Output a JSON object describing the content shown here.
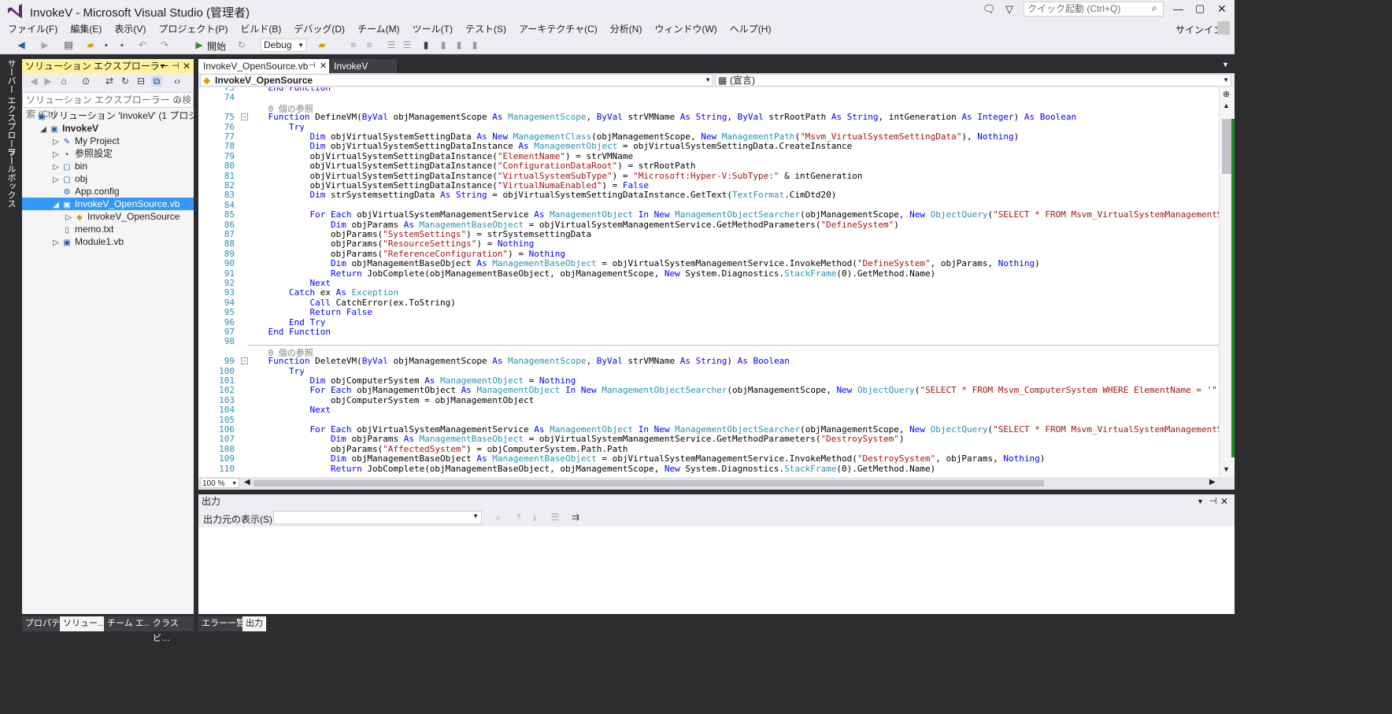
{
  "window": {
    "title": "InvokeV - Microsoft Visual Studio (管理者)",
    "quick_launch_placeholder": "クイック起動 (Ctrl+Q)",
    "sign_in": "サインイン"
  },
  "menu": [
    "ファイル(F)",
    "編集(E)",
    "表示(V)",
    "プロジェクト(P)",
    "ビルド(B)",
    "デバッグ(D)",
    "チーム(M)",
    "ツール(T)",
    "テスト(S)",
    "アーキテクチャ(C)",
    "分析(N)",
    "ウィンドウ(W)",
    "ヘルプ(H)"
  ],
  "toolbar": {
    "start_label": "開始",
    "config": "Debug"
  },
  "left_tabs": [
    "サーバー エクスプローラー",
    "ツールボックス"
  ],
  "solution_explorer": {
    "title": "ソリューション エクスプローラー",
    "search_placeholder": "ソリューション エクスプローラー の検索 (Ctrl",
    "tree": [
      {
        "label": "ソリューション 'InvokeV' (1 プロジェクト)",
        "level": 0,
        "icon": "solution-icon",
        "expander": ""
      },
      {
        "label": "InvokeV",
        "level": 1,
        "icon": "vb-project-icon",
        "expander": "◢",
        "bold": true
      },
      {
        "label": "My Project",
        "level": 2,
        "icon": "wrench-icon",
        "expander": "▷"
      },
      {
        "label": "参照設定",
        "level": 2,
        "icon": "references-icon",
        "expander": "▷"
      },
      {
        "label": "bin",
        "level": 2,
        "icon": "folder-icon",
        "expander": "▷"
      },
      {
        "label": "obj",
        "level": 2,
        "icon": "folder-icon",
        "expander": "▷"
      },
      {
        "label": "App.config",
        "level": 2,
        "icon": "config-icon",
        "expander": ""
      },
      {
        "label": "InvokeV_OpenSource.vb",
        "level": 2,
        "icon": "vb-file-icon",
        "expander": "◢",
        "selected": true
      },
      {
        "label": "InvokeV_OpenSource",
        "level": 3,
        "icon": "class-icon",
        "expander": "▷"
      },
      {
        "label": "memo.txt",
        "level": 2,
        "icon": "text-file-icon",
        "expander": ""
      },
      {
        "label": "Module1.vb",
        "level": 2,
        "icon": "vb-file-icon",
        "expander": "▷"
      }
    ],
    "bottom_tabs": [
      "プロパティ",
      "ソリュー…",
      "チーム エ…",
      "クラス ビ…"
    ]
  },
  "editor": {
    "tabs": [
      {
        "label": "InvokeV_OpenSource.vb",
        "active": true
      },
      {
        "label": "InvokeV",
        "active": false
      }
    ],
    "nav_left": "InvokeV_OpenSource",
    "nav_right": "(宣言)",
    "zoom": "100 %",
    "lines": [
      {
        "n": "73",
        "t": "    End Function"
      },
      {
        "n": "74",
        "t": ""
      },
      {
        "n": "",
        "t": "    0 個の参照"
      },
      {
        "n": "75",
        "t": "    Function DefineVM(ByVal objManagementScope As ManagementScope, ByVal strVMName As String, ByVal strRootPath As String, intGeneration As Integer) As Boolean"
      },
      {
        "n": "76",
        "t": "        Try"
      },
      {
        "n": "77",
        "t": "            Dim objVirtualSystemSettingData As New ManagementClass(objManagementScope, New ManagementPath(\"Msvm_VirtualSystemSettingData\"), Nothing)"
      },
      {
        "n": "78",
        "t": "            Dim objVirtualSystemSettingDataInstance As ManagementObject = objVirtualSystemSettingData.CreateInstance"
      },
      {
        "n": "79",
        "t": "            objVirtualSystemSettingDataInstance(\"ElementName\") = strVMName"
      },
      {
        "n": "80",
        "t": "            objVirtualSystemSettingDataInstance(\"ConfigurationDataRoot\") = strRootPath"
      },
      {
        "n": "81",
        "t": "            objVirtualSystemSettingDataInstance(\"VirtualSystemSubType\") = \"Microsoft:Hyper-V:SubType:\" & intGeneration"
      },
      {
        "n": "82",
        "t": "            objVirtualSystemSettingDataInstance(\"VirtualNumaEnabled\") = False"
      },
      {
        "n": "83",
        "t": "            Dim strSystemsettingData As String = objVirtualSystemSettingDataInstance.GetText(TextFormat.CimDtd20)"
      },
      {
        "n": "84",
        "t": ""
      },
      {
        "n": "85",
        "t": "            For Each objVirtualSystemManagementService As ManagementObject In New ManagementObjectSearcher(objManagementScope, New ObjectQuery(\"SELECT * FROM Msvm_VirtualSystemManagementService\")).Ge"
      },
      {
        "n": "86",
        "t": "                Dim objParams As ManagementBaseObject = objVirtualSystemManagementService.GetMethodParameters(\"DefineSystem\")"
      },
      {
        "n": "87",
        "t": "                objParams(\"SystemSettings\") = strSystemsettingData"
      },
      {
        "n": "88",
        "t": "                objParams(\"ResourceSettings\") = Nothing"
      },
      {
        "n": "89",
        "t": "                objParams(\"ReferenceConfiguration\") = Nothing"
      },
      {
        "n": "90",
        "t": "                Dim objManagementBaseObject As ManagementBaseObject = objVirtualSystemManagementService.InvokeMethod(\"DefineSystem\", objParams, Nothing)"
      },
      {
        "n": "91",
        "t": "                Return JobComplete(objManagementBaseObject, objManagementScope, New System.Diagnostics.StackFrame(0).GetMethod.Name)"
      },
      {
        "n": "92",
        "t": "            Next"
      },
      {
        "n": "93",
        "t": "        Catch ex As Exception"
      },
      {
        "n": "94",
        "t": "            Call CatchError(ex.ToString)"
      },
      {
        "n": "95",
        "t": "            Return False"
      },
      {
        "n": "96",
        "t": "        End Try"
      },
      {
        "n": "97",
        "t": "    End Function"
      },
      {
        "n": "98",
        "t": ""
      },
      {
        "n": "",
        "t": "    0 個の参照"
      },
      {
        "n": "99",
        "t": "    Function DeleteVM(ByVal objManagementScope As ManagementScope, ByVal strVMName As String) As Boolean"
      },
      {
        "n": "100",
        "t": "        Try"
      },
      {
        "n": "101",
        "t": "            Dim objComputerSystem As ManagementObject = Nothing"
      },
      {
        "n": "102",
        "t": "            For Each objManagementObject As ManagementObject In New ManagementObjectSearcher(objManagementScope, New ObjectQuery(\"SELECT * FROM Msvm_ComputerSystem WHERE ElementName = '\" & strVMName"
      },
      {
        "n": "103",
        "t": "                objComputerSystem = objManagementObject"
      },
      {
        "n": "104",
        "t": "            Next"
      },
      {
        "n": "105",
        "t": ""
      },
      {
        "n": "106",
        "t": "            For Each objVirtualSystemManagementService As ManagementObject In New ManagementObjectSearcher(objManagementScope, New ObjectQuery(\"SELECT * FROM Msvm_VirtualSystemManagementService\")).Ge"
      },
      {
        "n": "107",
        "t": "                Dim objParams As ManagementBaseObject = objVirtualSystemManagementService.GetMethodParameters(\"DestroySystem\")"
      },
      {
        "n": "108",
        "t": "                objParams(\"AffectedSystem\") = objComputerSystem.Path.Path"
      },
      {
        "n": "109",
        "t": "                Dim objManagementBaseObject As ManagementBaseObject = objVirtualSystemManagementService.InvokeMethod(\"DestroySystem\", objParams, Nothing)"
      },
      {
        "n": "110",
        "t": "                Return JobComplete(objManagementBaseObject, objManagementScope, New System.Diagnostics.StackFrame(0).GetMethod.Name)"
      }
    ]
  },
  "output": {
    "title": "出力",
    "source_label": "出力元の表示(S):",
    "source_value": "",
    "bottom_tabs": [
      "エラー一覧",
      "出力"
    ]
  },
  "colors": {
    "accent": "#007acc",
    "selection": "#3399ff",
    "explorer_header": "#fff29d",
    "keyword": "#0000ff",
    "type": "#2b91af",
    "string": "#a31515"
  }
}
